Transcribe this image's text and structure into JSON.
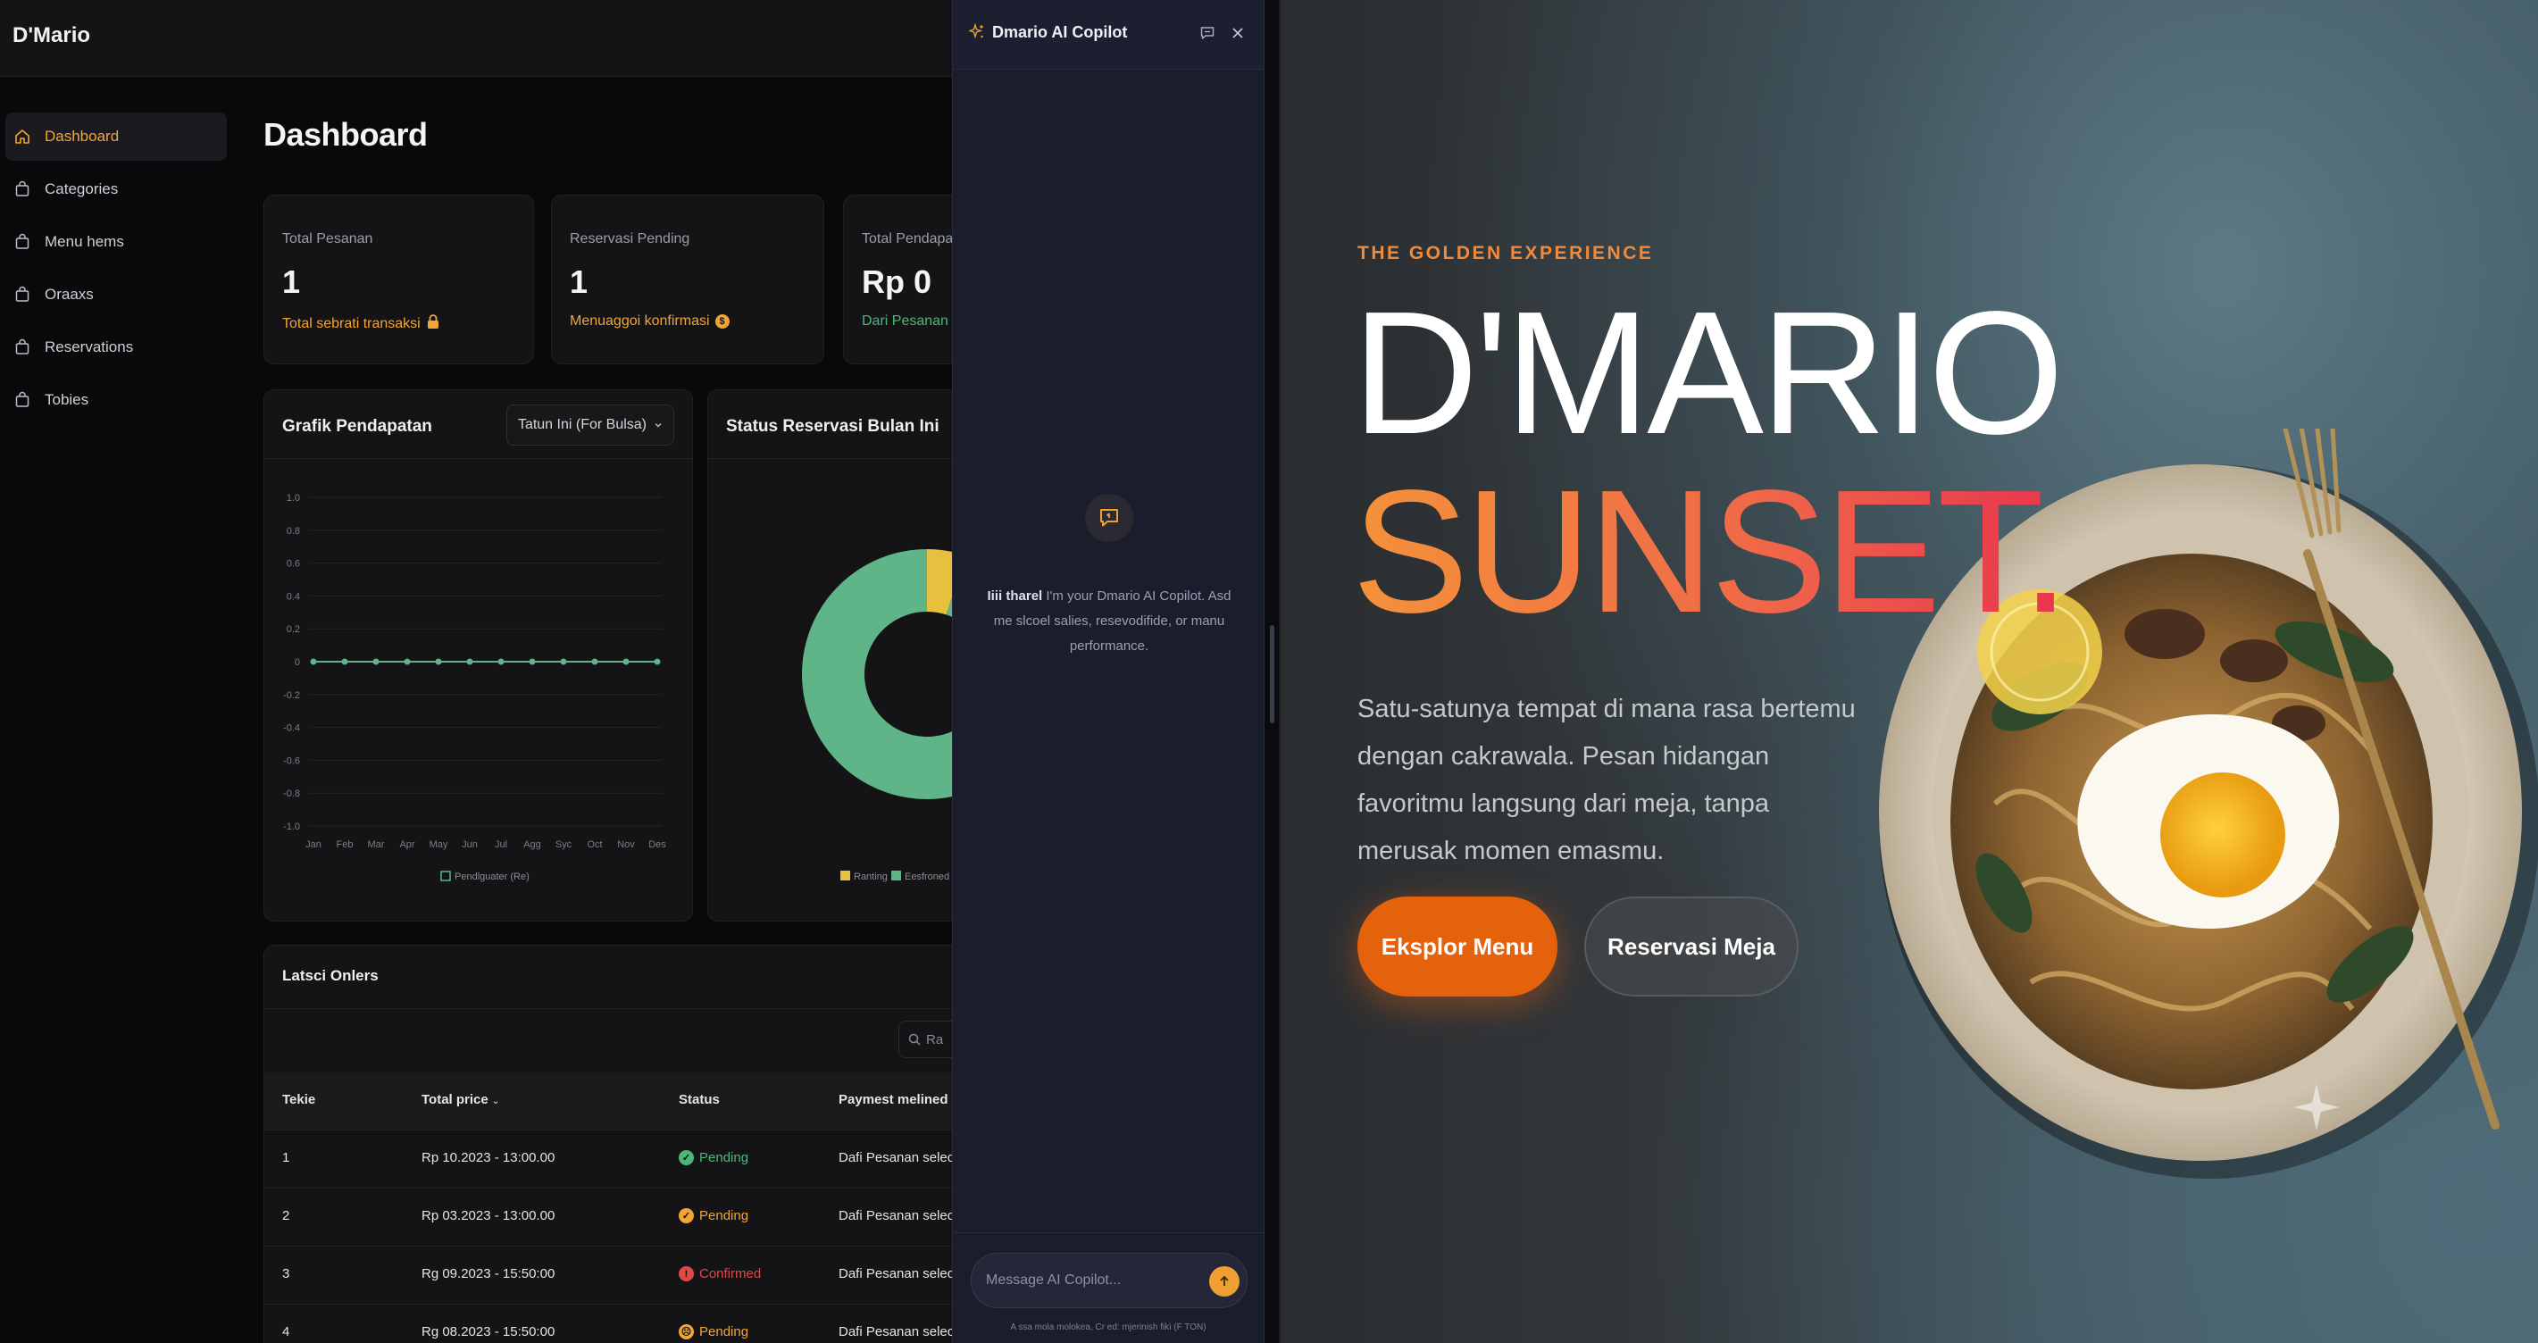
{
  "app": {
    "brand": "D'Mario"
  },
  "sidebar": {
    "items": [
      {
        "label": "Dashboard",
        "active": true
      },
      {
        "label": "Categories",
        "active": false
      },
      {
        "label": "Menu hems",
        "active": false
      },
      {
        "label": "Oraaxs",
        "active": false
      },
      {
        "label": "Reservations",
        "active": false
      },
      {
        "label": "Tobies",
        "active": false
      }
    ]
  },
  "page": {
    "title": "Dashboard"
  },
  "kpis": [
    {
      "label": "Total Pesanan",
      "value": "1",
      "sub": "Total sebrati transaksi",
      "sub_color": "#f3a534"
    },
    {
      "label": "Reservasi Pending",
      "value": "1",
      "sub": "Menuaggoi konfirmasi",
      "sub_color": "#f3a534"
    },
    {
      "label": "Total Pendapatan",
      "value": "Rp 0",
      "sub": "Dari Pesanan seis",
      "sub_color": "#4cb878"
    }
  ],
  "revenue_chart": {
    "title": "Grafik Pendapatan",
    "select_value": "Tatun Ini (For Bulsa)",
    "legend": "Pendlguater (Re)"
  },
  "reservation_chart": {
    "title": "Status Reservasi Bulan Ini",
    "legend": [
      "Ranting",
      "Eesfroned"
    ]
  },
  "chart_data": [
    {
      "type": "line",
      "title": "Grafik Pendapatan",
      "x": [
        "Jan",
        "Feb",
        "Mar",
        "Apr",
        "May",
        "Jun",
        "Jul",
        "Agg",
        "Syc",
        "Oct",
        "Nov",
        "Des"
      ],
      "series": [
        {
          "name": "Pendlguater (Re)",
          "values": [
            0,
            0,
            0,
            0,
            0,
            0,
            0,
            0,
            0,
            0,
            0,
            0
          ]
        }
      ],
      "yticks": [
        "1.0",
        "0.8",
        "0.6",
        "0.4",
        "0.2",
        "0",
        "-0.2",
        "-0.4",
        "-0.6",
        "-0.8",
        "-1.0"
      ],
      "ylim": [
        -1,
        1
      ],
      "grid": true,
      "legend_position": "bottom",
      "color": "#5fb587"
    },
    {
      "type": "pie",
      "title": "Status Reservasi Bulan Ini",
      "categories": [
        "Ranting",
        "Eesfroned"
      ],
      "values": [
        5,
        95
      ],
      "colors": [
        "#e8c040",
        "#5fb587"
      ]
    }
  ],
  "orders": {
    "title": "Latsci Onlers",
    "search_placeholder": "Ra",
    "columns": [
      "Tekie",
      "Total price",
      "Status",
      "Paymest melined"
    ],
    "rows": [
      {
        "id": "1",
        "price": "Rp 10.2023 - 13:00.00",
        "status": "Pending",
        "status_color": "#4cb878",
        "status_glyph": "✓",
        "payment": "Dafi Pesanan seleclin"
      },
      {
        "id": "2",
        "price": "Rp 03.2023 - 13:00.00",
        "status": "Pending",
        "status_color": "#f3a534",
        "status_glyph": "✓",
        "payment": "Dafi Pesanan selectio"
      },
      {
        "id": "3",
        "price": "Rg 09.2023 - 15:50:00",
        "status": "Confirmed",
        "status_color": "#e04848",
        "status_glyph": "!",
        "payment": "Dafi Pesanan selectio"
      },
      {
        "id": "4",
        "price": "Rg 08.2023 - 15:50:00",
        "status": "Pending",
        "status_color": "#f3a534",
        "status_glyph": "☹",
        "payment": "Dafi Pesanan selectio"
      }
    ]
  },
  "copilot": {
    "title": "Dmario AI Copilot",
    "welcome_bold": "Iiii tharel",
    "welcome_text": "I'm your Dmario AI Copilot. Asd me slcoel salies, resevodifide, or manu performance.",
    "input_placeholder": "Message AI Copilot...",
    "disclaimer": "A ssa mola molokea, Cr ed: mjerinish fiki (F TON)"
  },
  "landing": {
    "eyebrow": "THE GOLDEN EXPERIENCE",
    "hero_line1": "D'MARIO",
    "hero_line2": "SUNSET.",
    "description": "Satu-satunya tempat di mana rasa bertemu dengan cakrawala. Pesan hidangan favoritmu langsung dari meja, tanpa merusak momen emasmu.",
    "cta_primary": "Eksplor Menu",
    "cta_secondary": "Reservasi Meja",
    "accent": "#e5620d"
  }
}
